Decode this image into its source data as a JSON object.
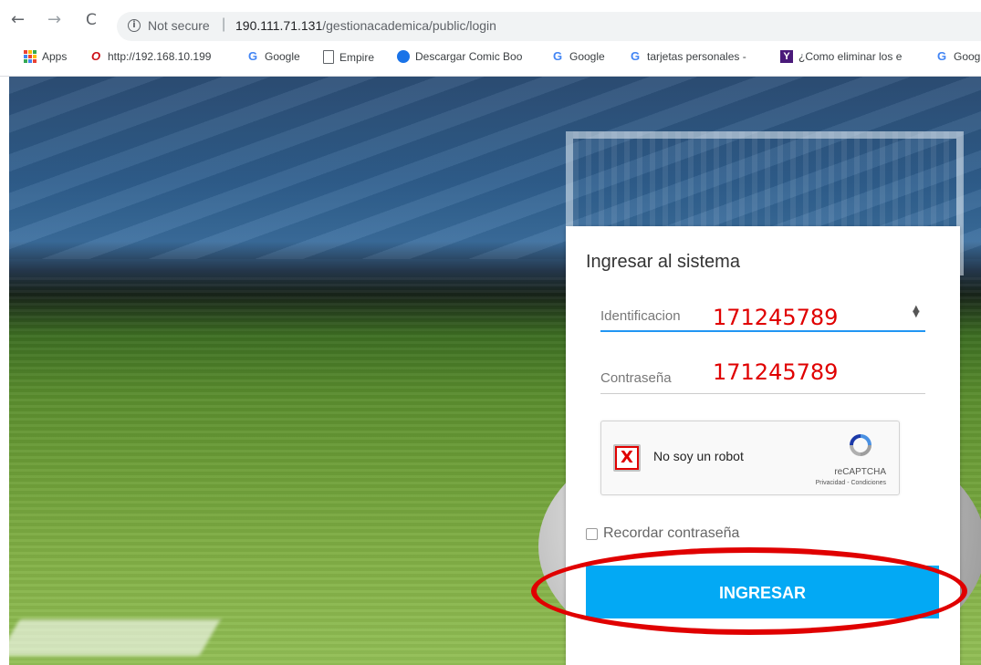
{
  "browser": {
    "back_icon": "←",
    "forward_icon": "→",
    "reload_icon": "C",
    "security_text": "Not secure",
    "separator": "|",
    "url_host": "190.111.71.131",
    "url_path": "/gestionacademica/public/login"
  },
  "bookmarks": [
    {
      "icon": "apps-grid",
      "label": "Apps"
    },
    {
      "icon": "opera-o",
      "label": "http://192.168.10.199"
    },
    {
      "icon": "google-g",
      "label": "Google"
    },
    {
      "icon": "document",
      "label": "Empire"
    },
    {
      "icon": "comic-icon",
      "label": "Descargar Comic Boo"
    },
    {
      "icon": "google-g",
      "label": "Google"
    },
    {
      "icon": "google-g",
      "label": "tarjetas personales -"
    },
    {
      "icon": "yahoo-y",
      "label": "¿Como eliminar los e"
    },
    {
      "icon": "google-g",
      "label": "Goog"
    }
  ],
  "login": {
    "title": "Ingresar al sistema",
    "id_label": "Identificacion",
    "password_label": "Contraseña",
    "captcha_label": "No soy un robot",
    "captcha_brand": "reCAPTCHA",
    "captcha_links": "Privacidad - Condiciones",
    "remember_label": "Recordar contraseña",
    "submit_label": "INGRESAR"
  },
  "annotations": {
    "id_value": "171245789",
    "password_value": "171245789",
    "captcha_mark": "X"
  },
  "colors": {
    "button": "#03a9f4",
    "annotation": "#e00000",
    "focus_line": "#2196f3"
  }
}
